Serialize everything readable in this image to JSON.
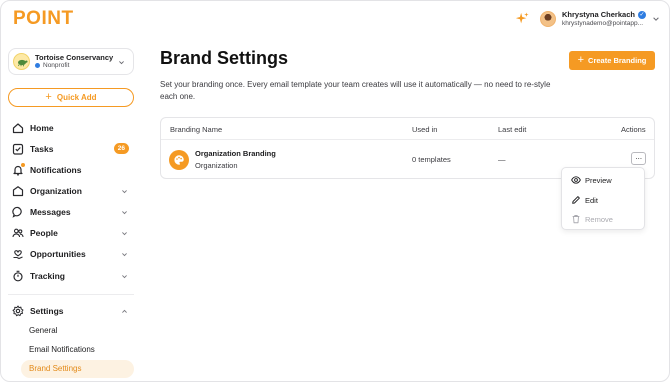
{
  "app": {
    "logo": "POINT",
    "accent": "#f59a23"
  },
  "user": {
    "name": "Khrystyna Cherkach",
    "email": "khrystynademo@pointapp...",
    "verified_icon": "check-badge-icon"
  },
  "org": {
    "name": "Tortoise Conservancy",
    "type": "Nonprofit"
  },
  "quick_add": {
    "label": "Quick Add"
  },
  "nav": {
    "home": "Home",
    "tasks": "Tasks",
    "tasks_badge": "26",
    "notifications": "Notifications",
    "organization": "Organization",
    "messages": "Messages",
    "people": "People",
    "opportunities": "Opportunities",
    "tracking": "Tracking",
    "settings": "Settings"
  },
  "settings_sub": {
    "general": "General",
    "email_notifications": "Email Notifications",
    "brand_settings": "Brand Settings"
  },
  "page": {
    "title": "Brand Settings",
    "create_label": "Create Branding",
    "description": "Set your branding once. Every email template your team creates will use it automatically — no need to re-style each one."
  },
  "table": {
    "headers": {
      "name": "Branding Name",
      "used_in": "Used in",
      "last_edit": "Last edit",
      "actions": "Actions"
    },
    "rows": [
      {
        "name": "Organization Branding",
        "subtitle": "Organization",
        "used_in": "0 templates",
        "last_edit": "—",
        "more": "···"
      }
    ]
  },
  "menu": {
    "preview": "Preview",
    "edit": "Edit",
    "remove": "Remove"
  }
}
